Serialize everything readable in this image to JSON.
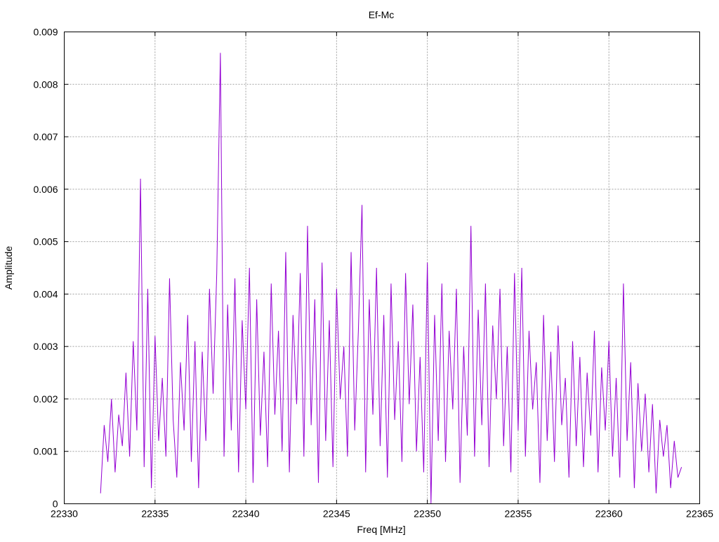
{
  "chart_data": {
    "type": "line",
    "title": "Ef-Mc",
    "xlabel": "Freq [MHz]",
    "ylabel": "Amplitude",
    "xlim": [
      22330,
      22365
    ],
    "ylim": [
      0,
      0.009
    ],
    "grid": true,
    "x_ticks": [
      "22330",
      "22335",
      "22340",
      "22345",
      "22350",
      "22355",
      "22360",
      "22365"
    ],
    "y_ticks": [
      "0",
      "0.001",
      "0.002",
      "0.003",
      "0.004",
      "0.005",
      "0.006",
      "0.007",
      "0.008",
      "0.009"
    ],
    "series": [
      {
        "name": "Ef-Mc",
        "color": "#9400d3",
        "x_start": 22332.0,
        "x_step": 0.2,
        "values": [
          0.0002,
          0.0015,
          0.0008,
          0.002,
          0.0006,
          0.0017,
          0.0011,
          0.0025,
          0.0009,
          0.0031,
          0.0014,
          0.0062,
          0.0007,
          0.0041,
          0.0003,
          0.0032,
          0.0012,
          0.0024,
          0.0009,
          0.0043,
          0.0016,
          0.0005,
          0.0027,
          0.0014,
          0.0036,
          0.0008,
          0.0031,
          0.0003,
          0.0029,
          0.0012,
          0.0041,
          0.0021,
          0.0044,
          0.0086,
          0.0009,
          0.0038,
          0.0014,
          0.0043,
          0.0006,
          0.0035,
          0.0018,
          0.0045,
          0.0004,
          0.0039,
          0.0013,
          0.0029,
          0.0007,
          0.0042,
          0.0017,
          0.0033,
          0.001,
          0.0048,
          0.0006,
          0.0036,
          0.0019,
          0.0044,
          0.0009,
          0.0053,
          0.0015,
          0.0039,
          0.0004,
          0.0046,
          0.0012,
          0.0035,
          0.0007,
          0.0041,
          0.002,
          0.003,
          0.0009,
          0.0048,
          0.0014,
          0.0033,
          0.0057,
          0.0006,
          0.0039,
          0.0017,
          0.0045,
          0.0011,
          0.0036,
          0.0005,
          0.0042,
          0.0016,
          0.0031,
          0.0008,
          0.0044,
          0.0019,
          0.0038,
          0.001,
          0.0028,
          0.0006,
          0.0046,
          0.0,
          0.0036,
          0.0012,
          0.0042,
          0.0008,
          0.0033,
          0.0018,
          0.0041,
          0.0004,
          0.003,
          0.0013,
          0.0053,
          0.0009,
          0.0037,
          0.0015,
          0.0042,
          0.0007,
          0.0034,
          0.002,
          0.0041,
          0.0011,
          0.003,
          0.0006,
          0.0044,
          0.0014,
          0.0045,
          0.0009,
          0.0033,
          0.0018,
          0.0027,
          0.0004,
          0.0036,
          0.0012,
          0.0029,
          0.0008,
          0.0034,
          0.0015,
          0.0024,
          0.0005,
          0.0031,
          0.0011,
          0.0028,
          0.0007,
          0.0025,
          0.0013,
          0.0033,
          0.0006,
          0.0026,
          0.0014,
          0.0031,
          0.0009,
          0.0024,
          0.0005,
          0.0042,
          0.0012,
          0.0027,
          0.0003,
          0.0023,
          0.001,
          0.0021,
          0.0006,
          0.0019,
          0.0002,
          0.0016,
          0.0009,
          0.0015,
          0.0003,
          0.0012,
          0.0005,
          0.0007
        ]
      }
    ]
  }
}
